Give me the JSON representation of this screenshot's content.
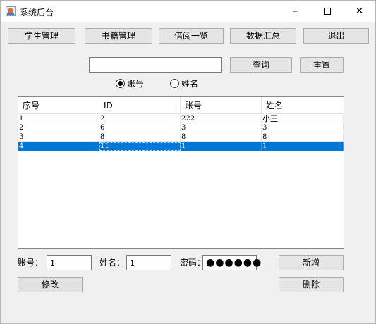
{
  "window": {
    "title": "系统后台",
    "minimize_glyph": "–",
    "close_glyph": "✕"
  },
  "nav": {
    "student": "学生管理",
    "books": "书籍管理",
    "borrow": "借阅一览",
    "summary": "数据汇总",
    "logout": "退出"
  },
  "search": {
    "value": "",
    "query_button": "查询",
    "reset_button": "重置",
    "radio_account": "账号",
    "radio_name": "姓名",
    "selected": "account"
  },
  "table": {
    "columns": [
      "序号",
      "ID",
      "账号",
      "姓名"
    ],
    "rows": [
      [
        "1",
        "2",
        "222",
        "小王"
      ],
      [
        "2",
        "6",
        "3",
        "3"
      ],
      [
        "3",
        "8",
        "8",
        "8"
      ],
      [
        "4",
        "11",
        "1",
        "1"
      ]
    ],
    "selected_row": 4
  },
  "form": {
    "account_label": "账号：",
    "account_value": "1",
    "name_label": "姓名：",
    "name_value": "1",
    "password_label": "密码：",
    "password_mask": "●●●●●●",
    "add_button": "新增",
    "edit_button": "修改",
    "delete_button": "删除"
  }
}
